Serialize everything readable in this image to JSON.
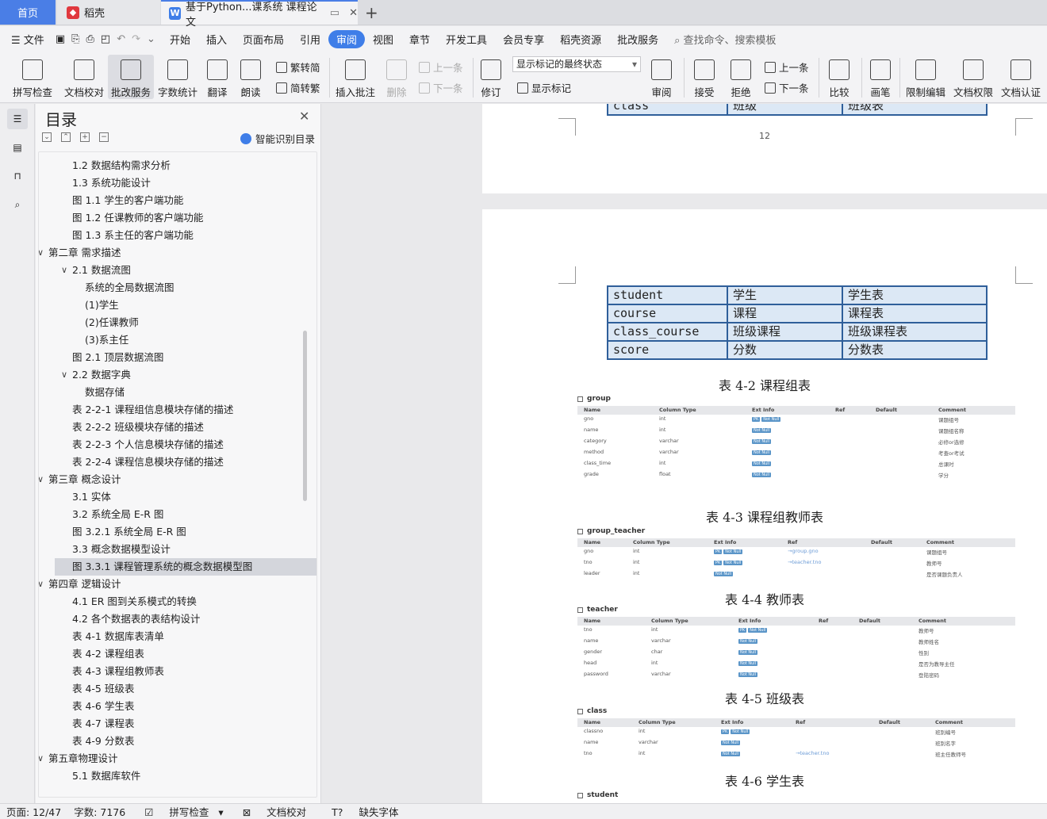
{
  "tabs": {
    "home": "首页",
    "daoke": "稻壳",
    "document": "基于Python...课系统 课程论文"
  },
  "menu": [
    "文件",
    "开始",
    "插入",
    "页面布局",
    "引用",
    "审阅",
    "视图",
    "章节",
    "开发工具",
    "会员专享",
    "稻壳资源",
    "批改服务"
  ],
  "menu_active": "审阅",
  "search_placeholder": "查找命令、搜索模板",
  "ribbon": {
    "spellcheck": "拼写检查",
    "doc_proof": "文档校对",
    "correction_service": "批改服务",
    "word_count": "字数统计",
    "translate": "翻译",
    "read_aloud": "朗读",
    "to_traditional": "繁转简",
    "to_simplified": "简转繁",
    "insert_comment": "插入批注",
    "delete": "删除",
    "prev_comment": "上一条",
    "next_comment": "下一条",
    "revise": "修订",
    "markup_state": "显示标记的最终状态",
    "show_markup": "显示标记",
    "review": "审阅",
    "accept": "接受",
    "reject": "拒绝",
    "prev_change": "上一条",
    "next_change": "下一条",
    "compare": "比较",
    "pen": "画笔",
    "restrict_edit": "限制编辑",
    "doc_permission": "文档权限",
    "doc_auth": "文档认证"
  },
  "toc": {
    "title": "目录",
    "smart_label": "智能识别目录",
    "items": [
      {
        "text": "1.2  数据结构需求分析",
        "level": 2
      },
      {
        "text": "1.3 系统功能设计",
        "level": 2
      },
      {
        "text": "图 1.1  学生的客户端功能",
        "level": 2
      },
      {
        "text": "图 1.2  任课教师的客户端功能",
        "level": 2
      },
      {
        "text": "图 1.3  系主任的客户端功能",
        "level": 2
      },
      {
        "text": "第二章  需求描述",
        "level": 1,
        "expanded": true
      },
      {
        "text": "2.1  数据流图",
        "level": 2,
        "expanded": true
      },
      {
        "text": "系统的全局数据流图",
        "level": 3
      },
      {
        "text": "(1)学生",
        "level": 3
      },
      {
        "text": "(2)任课教师",
        "level": 3
      },
      {
        "text": "(3)系主任",
        "level": 3
      },
      {
        "text": "图 2.1  顶层数据流图",
        "level": 2
      },
      {
        "text": "2.2  数据字典",
        "level": 2,
        "expanded": true
      },
      {
        "text": "数据存储",
        "level": 3
      },
      {
        "text": "表 2-2-1  课程组信息模块存储的描述",
        "level": 2
      },
      {
        "text": "表 2-2-2  班级模块存储的描述",
        "level": 2
      },
      {
        "text": "表 2-2-3  个人信息模块存储的描述",
        "level": 2
      },
      {
        "text": "表 2-2-4  课程信息模块存储的描述",
        "level": 2
      },
      {
        "text": "第三章    概念设计",
        "level": 1,
        "expanded": true
      },
      {
        "text": "3.1  实体",
        "level": 2
      },
      {
        "text": "3.2  系统全局 E-R 图",
        "level": 2
      },
      {
        "text": "图 3.2.1  系统全局 E-R 图",
        "level": 2
      },
      {
        "text": "3.3  概念数据模型设计",
        "level": 2
      },
      {
        "text": "图 3.3.1  课程管理系统的概念数据模型图",
        "level": 2,
        "selected": true
      },
      {
        "text": "第四章  逻辑设计",
        "level": 1,
        "expanded": true
      },
      {
        "text": "4.1 ER 图到关系模式的转换",
        "level": 2
      },
      {
        "text": "4.2    各个数据表的表结构设计",
        "level": 2
      },
      {
        "text": "表 4-1  数据库表清单",
        "level": 2
      },
      {
        "text": "表 4-2  课程组表",
        "level": 2
      },
      {
        "text": "表 4-3  课程组教师表",
        "level": 2
      },
      {
        "text": "表 4-5  班级表",
        "level": 2
      },
      {
        "text": "表 4-6  学生表",
        "level": 2
      },
      {
        "text": "表 4-7  课程表",
        "level": 2
      },
      {
        "text": "表 4-9  分数表",
        "level": 2
      },
      {
        "text": "第五章物理设计",
        "level": 1,
        "expanded": true
      },
      {
        "text": "5.1  数据库软件",
        "level": 2
      }
    ]
  },
  "doc": {
    "prev_row": [
      "class",
      "班级",
      "班级表"
    ],
    "page_number": "12",
    "table_rows": [
      [
        "student",
        "学生",
        "学生表"
      ],
      [
        "course",
        "课程",
        "课程表"
      ],
      [
        "class_course",
        "班级课程",
        "班级课程表"
      ],
      [
        "score",
        "分数",
        "分数表"
      ]
    ],
    "captions": [
      "表 4-2 课程组表",
      "表 4-3 课程组教师表",
      "表 4-4 教师表",
      "表 4-5 班级表",
      "表 4-6 学生表"
    ],
    "schema_headers": [
      "Name",
      "Column Type",
      "Ext Info",
      "Ref",
      "Default",
      "Comment"
    ],
    "schemas": [
      {
        "name": "group",
        "rows": [
          {
            "n": "gno",
            "t": "int",
            "pk": true,
            "ref": "",
            "cm": "课题组号"
          },
          {
            "n": "name",
            "t": "int",
            "pk": false,
            "ref": "",
            "cm": "课题组名称"
          },
          {
            "n": "category",
            "t": "varchar",
            "pk": false,
            "ref": "",
            "cm": "必修or选修"
          },
          {
            "n": "method",
            "t": "varchar",
            "pk": false,
            "ref": "",
            "cm": "考查or考试"
          },
          {
            "n": "class_time",
            "t": "int",
            "pk": false,
            "ref": "",
            "cm": "总课时"
          },
          {
            "n": "grade",
            "t": "float",
            "pk": false,
            "ref": "",
            "cm": "学分"
          }
        ]
      },
      {
        "name": "group_teacher",
        "rows": [
          {
            "n": "gno",
            "t": "int",
            "pk": true,
            "ref": "→group.gno",
            "cm": "课题组号"
          },
          {
            "n": "tno",
            "t": "int",
            "pk": true,
            "ref": "→teacher.tno",
            "cm": "教师号"
          },
          {
            "n": "leader",
            "t": "int",
            "pk": false,
            "ref": "",
            "cm": "是否课题负责人"
          }
        ]
      },
      {
        "name": "teacher",
        "rows": [
          {
            "n": "tno",
            "t": "int",
            "pk": true,
            "ref": "",
            "cm": "教师号"
          },
          {
            "n": "name",
            "t": "varchar",
            "pk": false,
            "ref": "",
            "cm": "教师姓名"
          },
          {
            "n": "gender",
            "t": "char",
            "pk": false,
            "ref": "",
            "cm": "性别"
          },
          {
            "n": "head",
            "t": "int",
            "pk": false,
            "ref": "",
            "cm": "是否为教导主任"
          },
          {
            "n": "password",
            "t": "varchar",
            "pk": false,
            "ref": "",
            "cm": "登陆密码"
          }
        ]
      },
      {
        "name": "class",
        "rows": [
          {
            "n": "classno",
            "t": "int",
            "pk": true,
            "ref": "",
            "cm": "班别编号"
          },
          {
            "n": "name",
            "t": "varchar",
            "pk": false,
            "ref": "",
            "cm": "班别名字"
          },
          {
            "n": "tno",
            "t": "int",
            "pk": false,
            "ref": "→teacher.tno",
            "cm": "班主任教师号"
          }
        ]
      },
      {
        "name": "student",
        "rows": []
      }
    ],
    "pill_pk": "PK",
    "pill_nn": "Not Null"
  },
  "status": {
    "page": "页面: 12/47",
    "words": "字数: 7176",
    "spellcheck": "拼写检查",
    "proof": "文档校对",
    "missing_fonts": "缺失字体"
  }
}
